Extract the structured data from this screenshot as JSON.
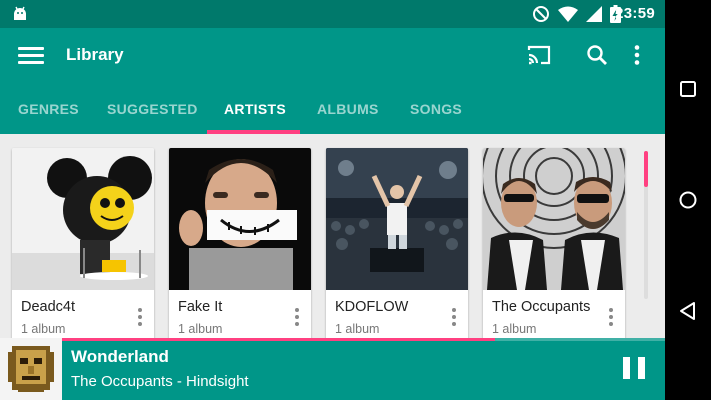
{
  "status_bar": {
    "time": "23:59"
  },
  "app_bar": {
    "title": "Library",
    "icons": [
      "menu-icon",
      "cast-icon",
      "search-icon",
      "more-vert-icon"
    ]
  },
  "tabs": [
    {
      "label": "GENRES",
      "active": false
    },
    {
      "label": "SUGGESTED",
      "active": false
    },
    {
      "label": "ARTISTS",
      "active": true
    },
    {
      "label": "ALBUMS",
      "active": false
    },
    {
      "label": "SONGS",
      "active": false
    }
  ],
  "artists": [
    {
      "name": "Deadc4t",
      "count": "1 album"
    },
    {
      "name": "Fake It",
      "count": "1 album"
    },
    {
      "name": "KDOFLOW",
      "count": "1 album"
    },
    {
      "name": "The Occupants",
      "count": "1 album"
    }
  ],
  "now_playing": {
    "title": "Wonderland",
    "subtitle": "The Occupants - Hindsight",
    "progress": 0.745,
    "state": "playing"
  },
  "colors": {
    "primary": "#009688",
    "primary_dark": "#00796b",
    "accent": "#ff4081"
  }
}
